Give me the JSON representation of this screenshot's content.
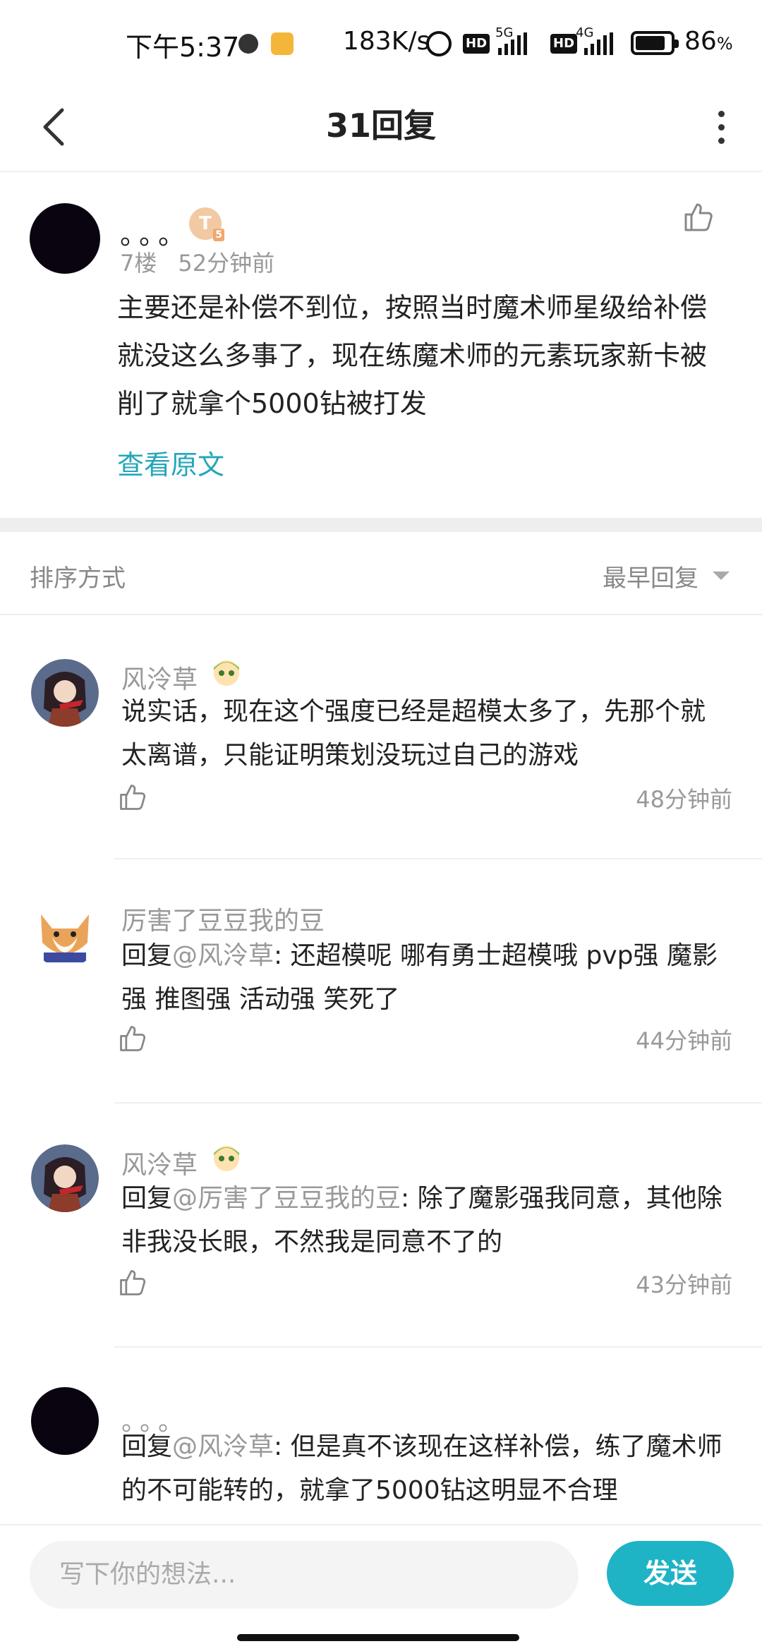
{
  "status_bar": {
    "time": "下午5:37",
    "speed": "183K/s",
    "hd1": "HD",
    "net1": "5G",
    "hd2": "HD",
    "net2": "4G",
    "battery_level": 0.86,
    "battery_pct": "86",
    "battery_unit": "%"
  },
  "header": {
    "title": "31回复"
  },
  "main_post": {
    "username": "。。。",
    "badge_letter": "T",
    "badge_level": "5",
    "floor": "7楼",
    "time": "52分钟前",
    "text": "主要还是补偿不到位，按照当时魔术师星级给补偿就没这么多事了，现在练魔术师的元素玩家新卡被削了就拿个5000钻被打发",
    "view_original": "查看原文"
  },
  "sort_bar": {
    "label": "排序方式",
    "value": "最早回复"
  },
  "replies": [
    {
      "name": "风泠草",
      "prefix": "",
      "at": "",
      "text": "说实话，现在这个强度已经是超模太多了，先那个就太离谱，只能证明策划没玩过自己的游戏",
      "time": "48分钟前"
    },
    {
      "name": "厉害了豆豆我的豆",
      "prefix": "回复",
      "at": "@风泠草",
      "text": ": 还超模呢  哪有勇士超模哦  pvp强  魔影强  推图强  活动强  笑死了",
      "time": "44分钟前"
    },
    {
      "name": "风泠草",
      "prefix": "回复",
      "at": "@厉害了豆豆我的豆",
      "text": ": 除了魔影强我同意，其他除非我没长眼，不然我是同意不了的",
      "time": "43分钟前"
    },
    {
      "name": "。。。",
      "prefix": "回复",
      "at": "@风泠草",
      "text": ": 但是真不该现在这样补偿，练了魔术师的不可能转的，就拿了5000钻这明显不合理",
      "time": ""
    }
  ],
  "composer": {
    "placeholder": "写下你的想法...",
    "send_label": "发送"
  },
  "colors": {
    "accent": "#1fb3c6",
    "link": "#23a6b9",
    "muted": "#999999"
  }
}
